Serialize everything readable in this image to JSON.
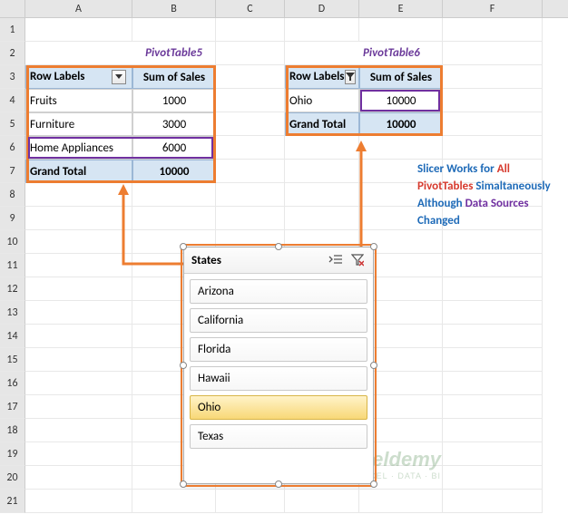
{
  "columns": [
    "A",
    "B",
    "C",
    "D",
    "E",
    "F"
  ],
  "rows": [
    "1",
    "2",
    "3",
    "4",
    "5",
    "6",
    "7",
    "8",
    "9",
    "10",
    "11",
    "12",
    "13",
    "14",
    "15",
    "16",
    "17",
    "18",
    "19",
    "20",
    "21"
  ],
  "chart_data": [
    {
      "type": "table",
      "title": "PivotTable5",
      "columns": [
        "Row Labels",
        "Sum of Sales"
      ],
      "rows": [
        {
          "label": "Fruits",
          "value": 1000
        },
        {
          "label": "Furniture",
          "value": 3000
        },
        {
          "label": "Home Appliances",
          "value": 6000
        }
      ],
      "total": {
        "label": "Grand Total",
        "value": 10000
      }
    },
    {
      "type": "table",
      "title": "PivotTable6",
      "columns": [
        "Row Labels",
        "Sum of Sales"
      ],
      "rows": [
        {
          "label": "Ohio",
          "value": 10000
        }
      ],
      "total": {
        "label": "Grand Total",
        "value": 10000
      }
    }
  ],
  "pivot5": {
    "title": "PivotTable5",
    "header_left": "Row Labels",
    "header_right": "Sum of Sales",
    "r1_label": "Fruits",
    "r1_val": "1000",
    "r2_label": "Furniture",
    "r2_val": "3000",
    "r3_label": "Home Appliances",
    "r3_val": "6000",
    "total_label": "Grand Total",
    "total_val": "10000"
  },
  "pivot6": {
    "title": "PivotTable6",
    "header_left": "Row Labels",
    "header_right": "Sum of Sales",
    "r1_label": "Ohio",
    "r1_val": "10000",
    "total_label": "Grand Total",
    "total_val": "10000"
  },
  "slicer": {
    "title": "States",
    "items": [
      "Arizona",
      "California",
      "Florida",
      "Hawaii",
      "Ohio",
      "Texas"
    ],
    "selected": "Ohio"
  },
  "annotation": {
    "t1": "Slicer Works for ",
    "t2": "All PivotTables",
    "t3": " Simaltaneously Although ",
    "t4": "Data Sources",
    "t5": " Changed"
  },
  "watermark": {
    "main": "exceldemy",
    "sub": "EXCEL · DATA · BI"
  }
}
